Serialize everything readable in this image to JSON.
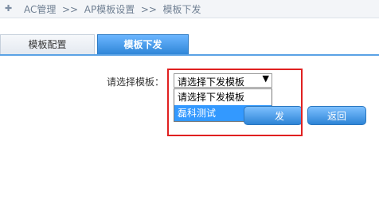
{
  "breadcrumb": {
    "icon": "ac-icon",
    "text": "AC管理  >>  AP模板设置  >>  模板下发"
  },
  "tabs": [
    {
      "label": "模板配置",
      "active": false
    },
    {
      "label": "模板下发",
      "active": true
    }
  ],
  "form": {
    "label": "请选择模板：",
    "select_value": "请选择下发模板",
    "options": [
      {
        "label": "请选择下发模板",
        "selected": false
      },
      {
        "label": "磊科测试",
        "selected": true
      }
    ]
  },
  "buttons": {
    "deploy_label": "发",
    "back_label": "返回"
  },
  "colors": {
    "accent": "#3a8fe0",
    "highlight_border": "#e02020"
  }
}
